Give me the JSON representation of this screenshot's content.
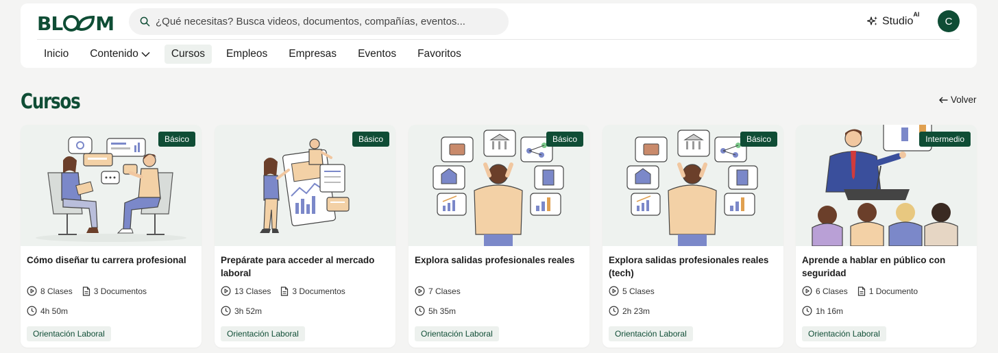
{
  "header": {
    "logo_text": "BLOOM",
    "search_placeholder": "¿Qué necesitas? Busca videos, documentos, compañías, eventos...",
    "studio_label": "Studio",
    "studio_sup": "AI",
    "avatar_initial": "C"
  },
  "nav": {
    "items": [
      "Inicio",
      "Contenido",
      "Cursos",
      "Empleos",
      "Empresas",
      "Eventos",
      "Favoritos"
    ],
    "active": "Cursos"
  },
  "page": {
    "title": "Cursos",
    "back_label": "Volver"
  },
  "courses": [
    {
      "title": "Cómo diseñar tu carrera profesional",
      "level": "Básico",
      "classes": "8 Clases",
      "documents": "3 Documentos",
      "duration": "4h 50m",
      "tag": "Orientación Laboral"
    },
    {
      "title": "Prepárate para acceder al mercado laboral",
      "level": "Básico",
      "classes": "13 Clases",
      "documents": "3 Documentos",
      "duration": "3h 52m",
      "tag": "Orientación Laboral"
    },
    {
      "title": "Explora salidas profesionales reales",
      "level": "Básico",
      "classes": "7 Clases",
      "documents": "",
      "duration": "5h 35m",
      "tag": "Orientación Laboral"
    },
    {
      "title": "Explora salidas profesionales reales (tech)",
      "level": "Básico",
      "classes": "5 Clases",
      "documents": "",
      "duration": "2h 23m",
      "tag": "Orientación Laboral"
    },
    {
      "title": "Aprende a hablar en público con seguridad",
      "level": "Intermedio",
      "classes": "6 Clases",
      "documents": "1 Documento",
      "duration": "1h 16m",
      "tag": "Orientación Laboral"
    }
  ],
  "colors": {
    "brand": "#0f4d35",
    "background": "#f4f4f3",
    "tag_bg": "#edf1ee"
  }
}
